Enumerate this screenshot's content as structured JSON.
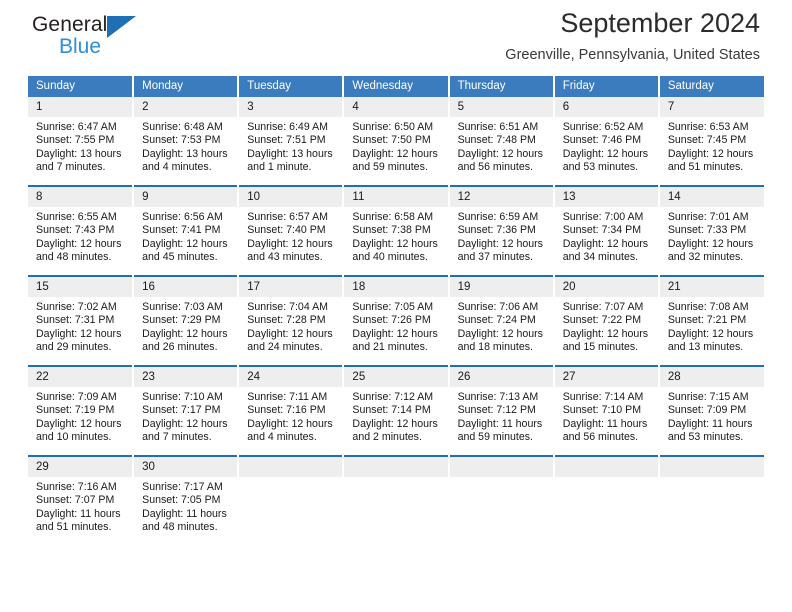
{
  "brand": {
    "line1": "General",
    "line2": "Blue",
    "triangle_color": "#1f6fb5"
  },
  "header": {
    "title": "September 2024",
    "location": "Greenville, Pennsylvania, United States",
    "header_bg": "#3b7cbf",
    "row_divider": "#1f6fb5",
    "daynum_bg": "#eeeeee"
  },
  "weekdays": [
    "Sunday",
    "Monday",
    "Tuesday",
    "Wednesday",
    "Thursday",
    "Friday",
    "Saturday"
  ],
  "labels": {
    "sunrise": "Sunrise:",
    "sunset": "Sunset:",
    "daylight": "Daylight:"
  },
  "weeks": [
    [
      {
        "day": "1",
        "sunrise": "Sunrise: 6:47 AM",
        "sunset": "Sunset: 7:55 PM",
        "daylight1": "Daylight: 13 hours",
        "daylight2": "and 7 minutes."
      },
      {
        "day": "2",
        "sunrise": "Sunrise: 6:48 AM",
        "sunset": "Sunset: 7:53 PM",
        "daylight1": "Daylight: 13 hours",
        "daylight2": "and 4 minutes."
      },
      {
        "day": "3",
        "sunrise": "Sunrise: 6:49 AM",
        "sunset": "Sunset: 7:51 PM",
        "daylight1": "Daylight: 13 hours",
        "daylight2": "and 1 minute."
      },
      {
        "day": "4",
        "sunrise": "Sunrise: 6:50 AM",
        "sunset": "Sunset: 7:50 PM",
        "daylight1": "Daylight: 12 hours",
        "daylight2": "and 59 minutes."
      },
      {
        "day": "5",
        "sunrise": "Sunrise: 6:51 AM",
        "sunset": "Sunset: 7:48 PM",
        "daylight1": "Daylight: 12 hours",
        "daylight2": "and 56 minutes."
      },
      {
        "day": "6",
        "sunrise": "Sunrise: 6:52 AM",
        "sunset": "Sunset: 7:46 PM",
        "daylight1": "Daylight: 12 hours",
        "daylight2": "and 53 minutes."
      },
      {
        "day": "7",
        "sunrise": "Sunrise: 6:53 AM",
        "sunset": "Sunset: 7:45 PM",
        "daylight1": "Daylight: 12 hours",
        "daylight2": "and 51 minutes."
      }
    ],
    [
      {
        "day": "8",
        "sunrise": "Sunrise: 6:55 AM",
        "sunset": "Sunset: 7:43 PM",
        "daylight1": "Daylight: 12 hours",
        "daylight2": "and 48 minutes."
      },
      {
        "day": "9",
        "sunrise": "Sunrise: 6:56 AM",
        "sunset": "Sunset: 7:41 PM",
        "daylight1": "Daylight: 12 hours",
        "daylight2": "and 45 minutes."
      },
      {
        "day": "10",
        "sunrise": "Sunrise: 6:57 AM",
        "sunset": "Sunset: 7:40 PM",
        "daylight1": "Daylight: 12 hours",
        "daylight2": "and 43 minutes."
      },
      {
        "day": "11",
        "sunrise": "Sunrise: 6:58 AM",
        "sunset": "Sunset: 7:38 PM",
        "daylight1": "Daylight: 12 hours",
        "daylight2": "and 40 minutes."
      },
      {
        "day": "12",
        "sunrise": "Sunrise: 6:59 AM",
        "sunset": "Sunset: 7:36 PM",
        "daylight1": "Daylight: 12 hours",
        "daylight2": "and 37 minutes."
      },
      {
        "day": "13",
        "sunrise": "Sunrise: 7:00 AM",
        "sunset": "Sunset: 7:34 PM",
        "daylight1": "Daylight: 12 hours",
        "daylight2": "and 34 minutes."
      },
      {
        "day": "14",
        "sunrise": "Sunrise: 7:01 AM",
        "sunset": "Sunset: 7:33 PM",
        "daylight1": "Daylight: 12 hours",
        "daylight2": "and 32 minutes."
      }
    ],
    [
      {
        "day": "15",
        "sunrise": "Sunrise: 7:02 AM",
        "sunset": "Sunset: 7:31 PM",
        "daylight1": "Daylight: 12 hours",
        "daylight2": "and 29 minutes."
      },
      {
        "day": "16",
        "sunrise": "Sunrise: 7:03 AM",
        "sunset": "Sunset: 7:29 PM",
        "daylight1": "Daylight: 12 hours",
        "daylight2": "and 26 minutes."
      },
      {
        "day": "17",
        "sunrise": "Sunrise: 7:04 AM",
        "sunset": "Sunset: 7:28 PM",
        "daylight1": "Daylight: 12 hours",
        "daylight2": "and 24 minutes."
      },
      {
        "day": "18",
        "sunrise": "Sunrise: 7:05 AM",
        "sunset": "Sunset: 7:26 PM",
        "daylight1": "Daylight: 12 hours",
        "daylight2": "and 21 minutes."
      },
      {
        "day": "19",
        "sunrise": "Sunrise: 7:06 AM",
        "sunset": "Sunset: 7:24 PM",
        "daylight1": "Daylight: 12 hours",
        "daylight2": "and 18 minutes."
      },
      {
        "day": "20",
        "sunrise": "Sunrise: 7:07 AM",
        "sunset": "Sunset: 7:22 PM",
        "daylight1": "Daylight: 12 hours",
        "daylight2": "and 15 minutes."
      },
      {
        "day": "21",
        "sunrise": "Sunrise: 7:08 AM",
        "sunset": "Sunset: 7:21 PM",
        "daylight1": "Daylight: 12 hours",
        "daylight2": "and 13 minutes."
      }
    ],
    [
      {
        "day": "22",
        "sunrise": "Sunrise: 7:09 AM",
        "sunset": "Sunset: 7:19 PM",
        "daylight1": "Daylight: 12 hours",
        "daylight2": "and 10 minutes."
      },
      {
        "day": "23",
        "sunrise": "Sunrise: 7:10 AM",
        "sunset": "Sunset: 7:17 PM",
        "daylight1": "Daylight: 12 hours",
        "daylight2": "and 7 minutes."
      },
      {
        "day": "24",
        "sunrise": "Sunrise: 7:11 AM",
        "sunset": "Sunset: 7:16 PM",
        "daylight1": "Daylight: 12 hours",
        "daylight2": "and 4 minutes."
      },
      {
        "day": "25",
        "sunrise": "Sunrise: 7:12 AM",
        "sunset": "Sunset: 7:14 PM",
        "daylight1": "Daylight: 12 hours",
        "daylight2": "and 2 minutes."
      },
      {
        "day": "26",
        "sunrise": "Sunrise: 7:13 AM",
        "sunset": "Sunset: 7:12 PM",
        "daylight1": "Daylight: 11 hours",
        "daylight2": "and 59 minutes."
      },
      {
        "day": "27",
        "sunrise": "Sunrise: 7:14 AM",
        "sunset": "Sunset: 7:10 PM",
        "daylight1": "Daylight: 11 hours",
        "daylight2": "and 56 minutes."
      },
      {
        "day": "28",
        "sunrise": "Sunrise: 7:15 AM",
        "sunset": "Sunset: 7:09 PM",
        "daylight1": "Daylight: 11 hours",
        "daylight2": "and 53 minutes."
      }
    ],
    [
      {
        "day": "29",
        "sunrise": "Sunrise: 7:16 AM",
        "sunset": "Sunset: 7:07 PM",
        "daylight1": "Daylight: 11 hours",
        "daylight2": "and 51 minutes."
      },
      {
        "day": "30",
        "sunrise": "Sunrise: 7:17 AM",
        "sunset": "Sunset: 7:05 PM",
        "daylight1": "Daylight: 11 hours",
        "daylight2": "and 48 minutes."
      },
      {
        "day": "",
        "sunrise": "",
        "sunset": "",
        "daylight1": "",
        "daylight2": ""
      },
      {
        "day": "",
        "sunrise": "",
        "sunset": "",
        "daylight1": "",
        "daylight2": ""
      },
      {
        "day": "",
        "sunrise": "",
        "sunset": "",
        "daylight1": "",
        "daylight2": ""
      },
      {
        "day": "",
        "sunrise": "",
        "sunset": "",
        "daylight1": "",
        "daylight2": ""
      },
      {
        "day": "",
        "sunrise": "",
        "sunset": "",
        "daylight1": "",
        "daylight2": ""
      }
    ]
  ]
}
